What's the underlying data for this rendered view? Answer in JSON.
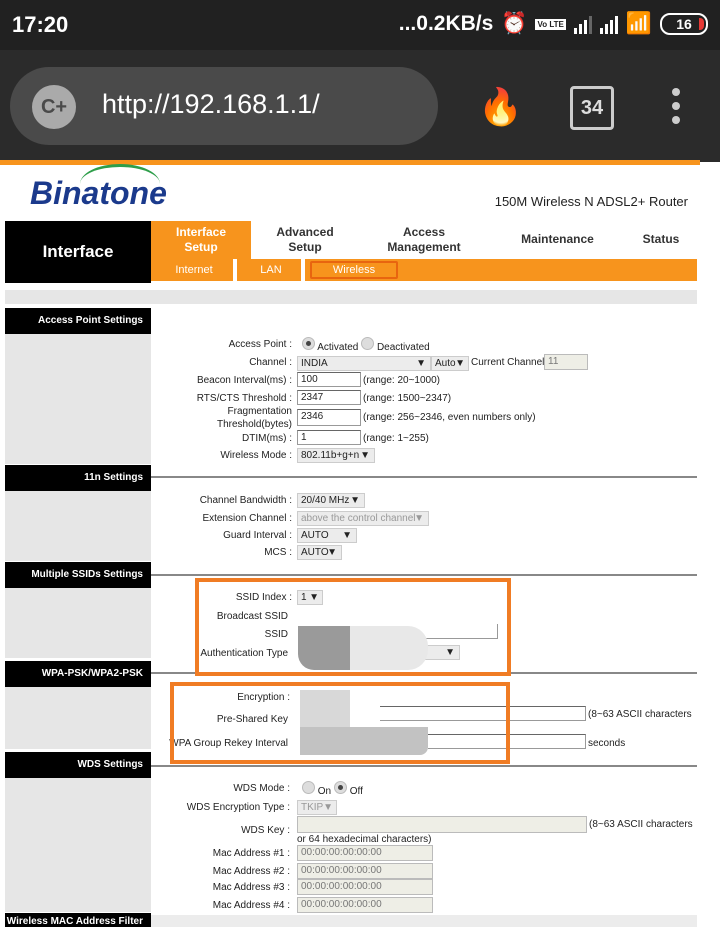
{
  "status_bar": {
    "time": "17:20",
    "net_speed": "...0.2KB/s",
    "volte": "Vo LTE",
    "battery": "16"
  },
  "browser": {
    "url": "http://192.168.1.1/",
    "tab_count": "34",
    "icons": [
      "cplus-icon",
      "flame-icon",
      "tabs-icon",
      "overflow-menu-icon"
    ]
  },
  "header": {
    "brand": "Binatone",
    "product": "150M Wireless N ADSL2+ Router"
  },
  "nav": {
    "section": "Interface",
    "tabs": [
      {
        "label": "Interface Setup",
        "active": true
      },
      {
        "label": "Advanced Setup"
      },
      {
        "label": "Access Management"
      },
      {
        "label": "Maintenance"
      },
      {
        "label": "Status"
      }
    ],
    "subtabs": [
      {
        "label": "Internet"
      },
      {
        "label": "LAN"
      },
      {
        "label": "Wireless",
        "active": true
      }
    ]
  },
  "sections": {
    "ap": "Access Point Settings",
    "n11": "11n Settings",
    "ssids": "Multiple SSIDs Settings",
    "wpa": "WPA-PSK/WPA2-PSK",
    "wds": "WDS Settings",
    "mac_filter": "Wireless MAC Address Filter"
  },
  "ap": {
    "access_point_label": "Access Point :",
    "activated": "Activated",
    "deactivated": "Deactivated",
    "channel_label": "Channel :",
    "channel_value": "INDIA",
    "channel_auto": "Auto",
    "current_channel_label": "Current Channel:",
    "current_channel": "11",
    "beacon_label": "Beacon Interval(ms) :",
    "beacon_value": "100",
    "beacon_range": "(range: 20~1000)",
    "rts_label": "RTS/CTS Threshold :",
    "rts_value": "2347",
    "rts_range": "(range: 1500~2347)",
    "frag_label1": "Fragmentation",
    "frag_label2": "Threshold(bytes)",
    "frag_value": "2346",
    "frag_range": "(range: 256~2346, even numbers only)",
    "dtim_label": "DTIM(ms) :",
    "dtim_value": "1",
    "dtim_range": "(range: 1~255)",
    "mode_label": "Wireless Mode :",
    "mode_value": "802.11b+g+n"
  },
  "n11": {
    "bw_label": "Channel Bandwidth :",
    "bw_value": "20/40 MHz",
    "ext_label": "Extension Channel :",
    "ext_value": "above the control channel",
    "guard_label": "Guard Interval :",
    "guard_value": "AUTO",
    "mcs_label": "MCS :",
    "mcs_value": "AUTO"
  },
  "ssid": {
    "index_label": "SSID Index :",
    "index_value": "1",
    "broadcast_label": "Broadcast SSID",
    "ssid_label": "SSID",
    "auth_label": "Authentication Type"
  },
  "wpa": {
    "enc_label": "Encryption :",
    "psk_label": "Pre-Shared Key",
    "psk_note": "(8~63 ASCII characters",
    "rekey_label": "WPA Group Rekey Interval",
    "rekey_note": "seconds"
  },
  "wds": {
    "mode_label": "WDS Mode :",
    "on": "On",
    "off": "Off",
    "enc_label": "WDS Encryption Type :",
    "enc_value": "TKIP",
    "key_label": "WDS Key :",
    "key_note": "(8~63 ASCII characters",
    "key_note2": "or 64 hexadecimal characters)",
    "macs": [
      {
        "label": "Mac Address #1 :",
        "value": "00:00:00:00:00:00"
      },
      {
        "label": "Mac Address #2 :",
        "value": "00:00:00:00:00:00"
      },
      {
        "label": "Mac Address #3 :",
        "value": "00:00:00:00:00:00"
      },
      {
        "label": "Mac Address #4 :",
        "value": "00:00:00:00:00:00"
      }
    ]
  }
}
